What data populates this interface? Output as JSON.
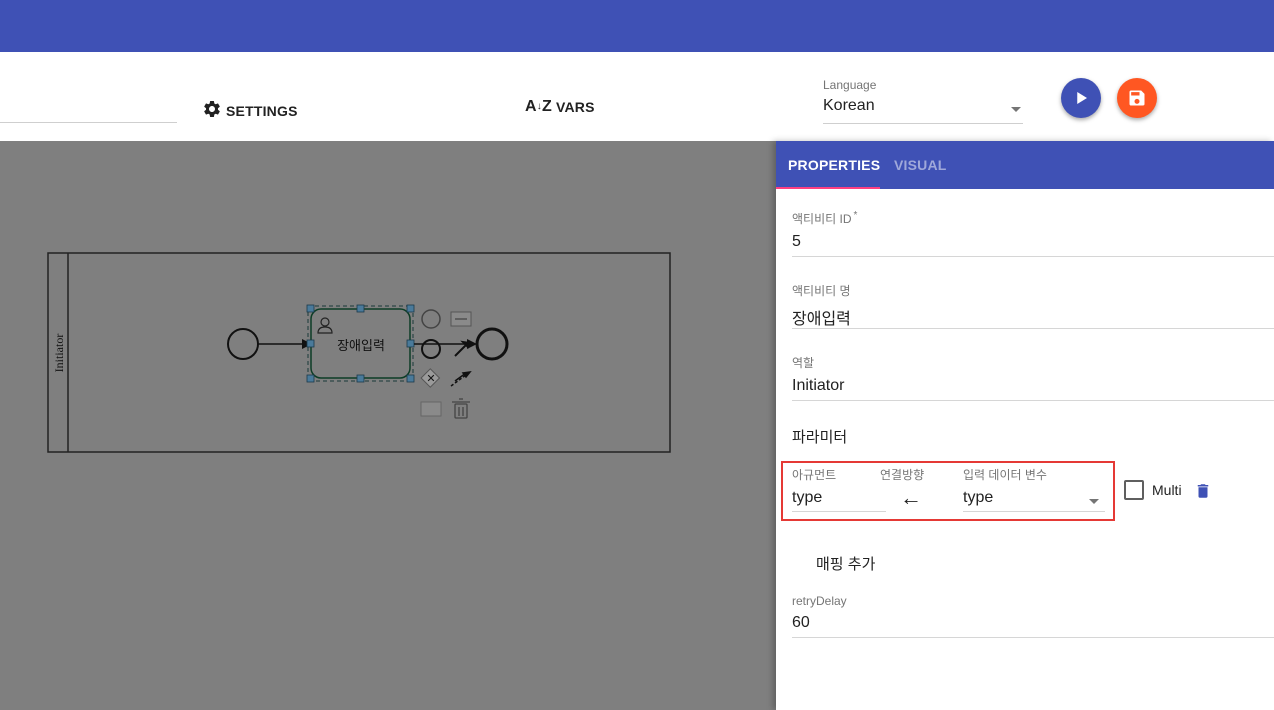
{
  "toolbar": {
    "settings_label": "SETTINGS",
    "vars_label": "VARS",
    "vars_icon": "A↓Z",
    "language": {
      "label": "Language",
      "value": "Korean"
    },
    "run_button": "play-icon",
    "save_button": "save-icon"
  },
  "colors": {
    "primary": "#3f51b5",
    "accent": "#ff5722",
    "tab_ink": "#ff4081",
    "highlight": "#e53935",
    "canvas": "#7f7f7f"
  },
  "diagram": {
    "lane_label": "Initiator",
    "task_label": "장애입력"
  },
  "panel": {
    "tabs": [
      {
        "label": "PROPERTIES"
      },
      {
        "label": "VISUAL"
      }
    ],
    "fields": {
      "activity_id": {
        "label": "액티비티 ID",
        "required_mark": "*",
        "value": "5"
      },
      "activity_name": {
        "label": "액티비티 명",
        "value": "장애입력"
      },
      "role": {
        "label": "역할",
        "value": "Initiator"
      }
    },
    "parameters_title": "파라미터",
    "parameter": {
      "argument": {
        "label": "아규먼트",
        "value": "type"
      },
      "direction": {
        "label": "연결방향",
        "value": "←"
      },
      "input_var": {
        "label": "입력 데이터 변수",
        "value": "type"
      },
      "multi_label": "Multi"
    },
    "add_mapping": "매핑 추가",
    "retry": {
      "label": "retryDelay",
      "value": "60"
    }
  }
}
